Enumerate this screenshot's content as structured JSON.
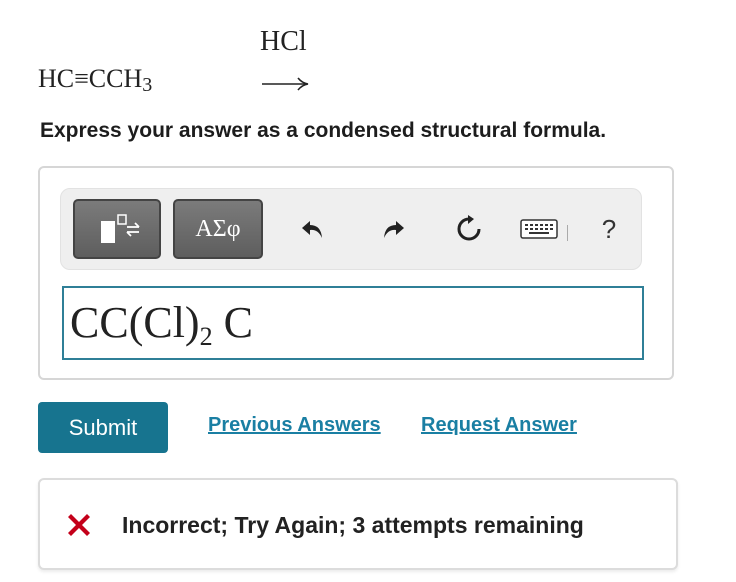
{
  "reaction": {
    "reagent": "HCl",
    "reactant_main": "HC≡CCH",
    "reactant_subscript": "3"
  },
  "prompt": "Express your answer as a condensed structural formula.",
  "toolbar": {
    "templates_icon": "templates-icon",
    "symbols_label": "ΑΣφ",
    "undo_icon": "undo-icon",
    "redo_icon": "redo-icon",
    "reset_icon": "reset-icon",
    "keyboard_icon": "keyboard-icon",
    "help_label": "?"
  },
  "answer": {
    "part1": "CC(Cl)",
    "subscript": "2",
    "part2": " C",
    "border_color": "#2f7f97"
  },
  "actions": {
    "submit_label": "Submit",
    "previous_answers": "Previous Answers",
    "request_answer": "Request Answer",
    "submit_color": "#17748f",
    "link_color": "#1a7fa3"
  },
  "feedback": {
    "icon": "x-icon",
    "text": "Incorrect; Try Again; 3 attempts remaining",
    "icon_color": "#c4001a"
  }
}
